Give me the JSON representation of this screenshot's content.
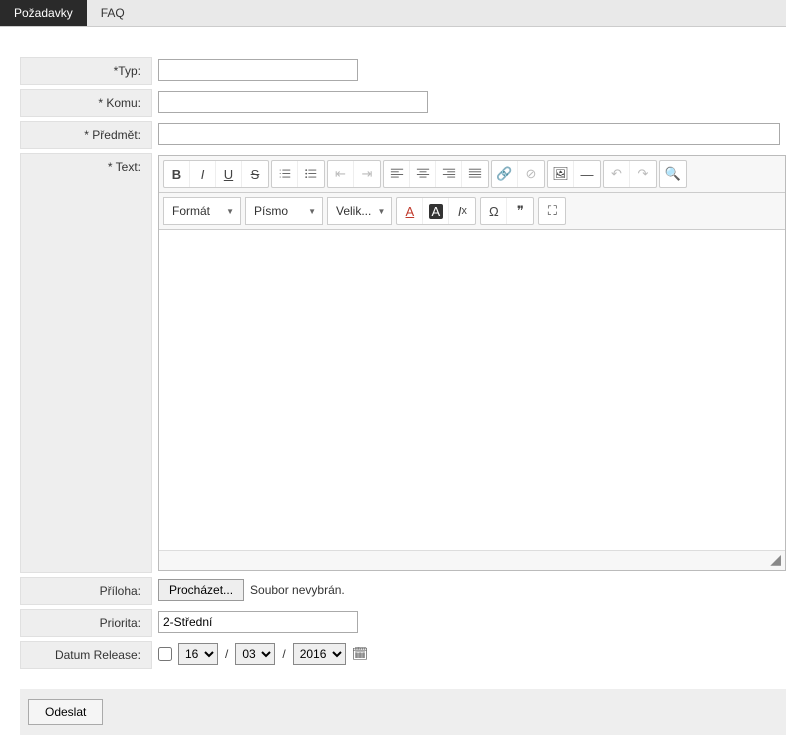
{
  "tabs": {
    "active": "Požadavky",
    "other": "FAQ"
  },
  "labels": {
    "typ": "*Typ:",
    "komu": "* Komu:",
    "predmet": "* Předmět:",
    "text": "* Text:",
    "priloha": "Příloha:",
    "priorita": "Priorita:",
    "datum": "Datum Release:"
  },
  "editor": {
    "format": "Formát",
    "font": "Písmo",
    "size": "Velik..."
  },
  "file": {
    "browse": "Procházet...",
    "status": "Soubor nevybrán."
  },
  "priority": {
    "value": "2-Střední"
  },
  "date": {
    "day": "16",
    "month": "03",
    "year": "2016"
  },
  "submit": "Odeslat"
}
